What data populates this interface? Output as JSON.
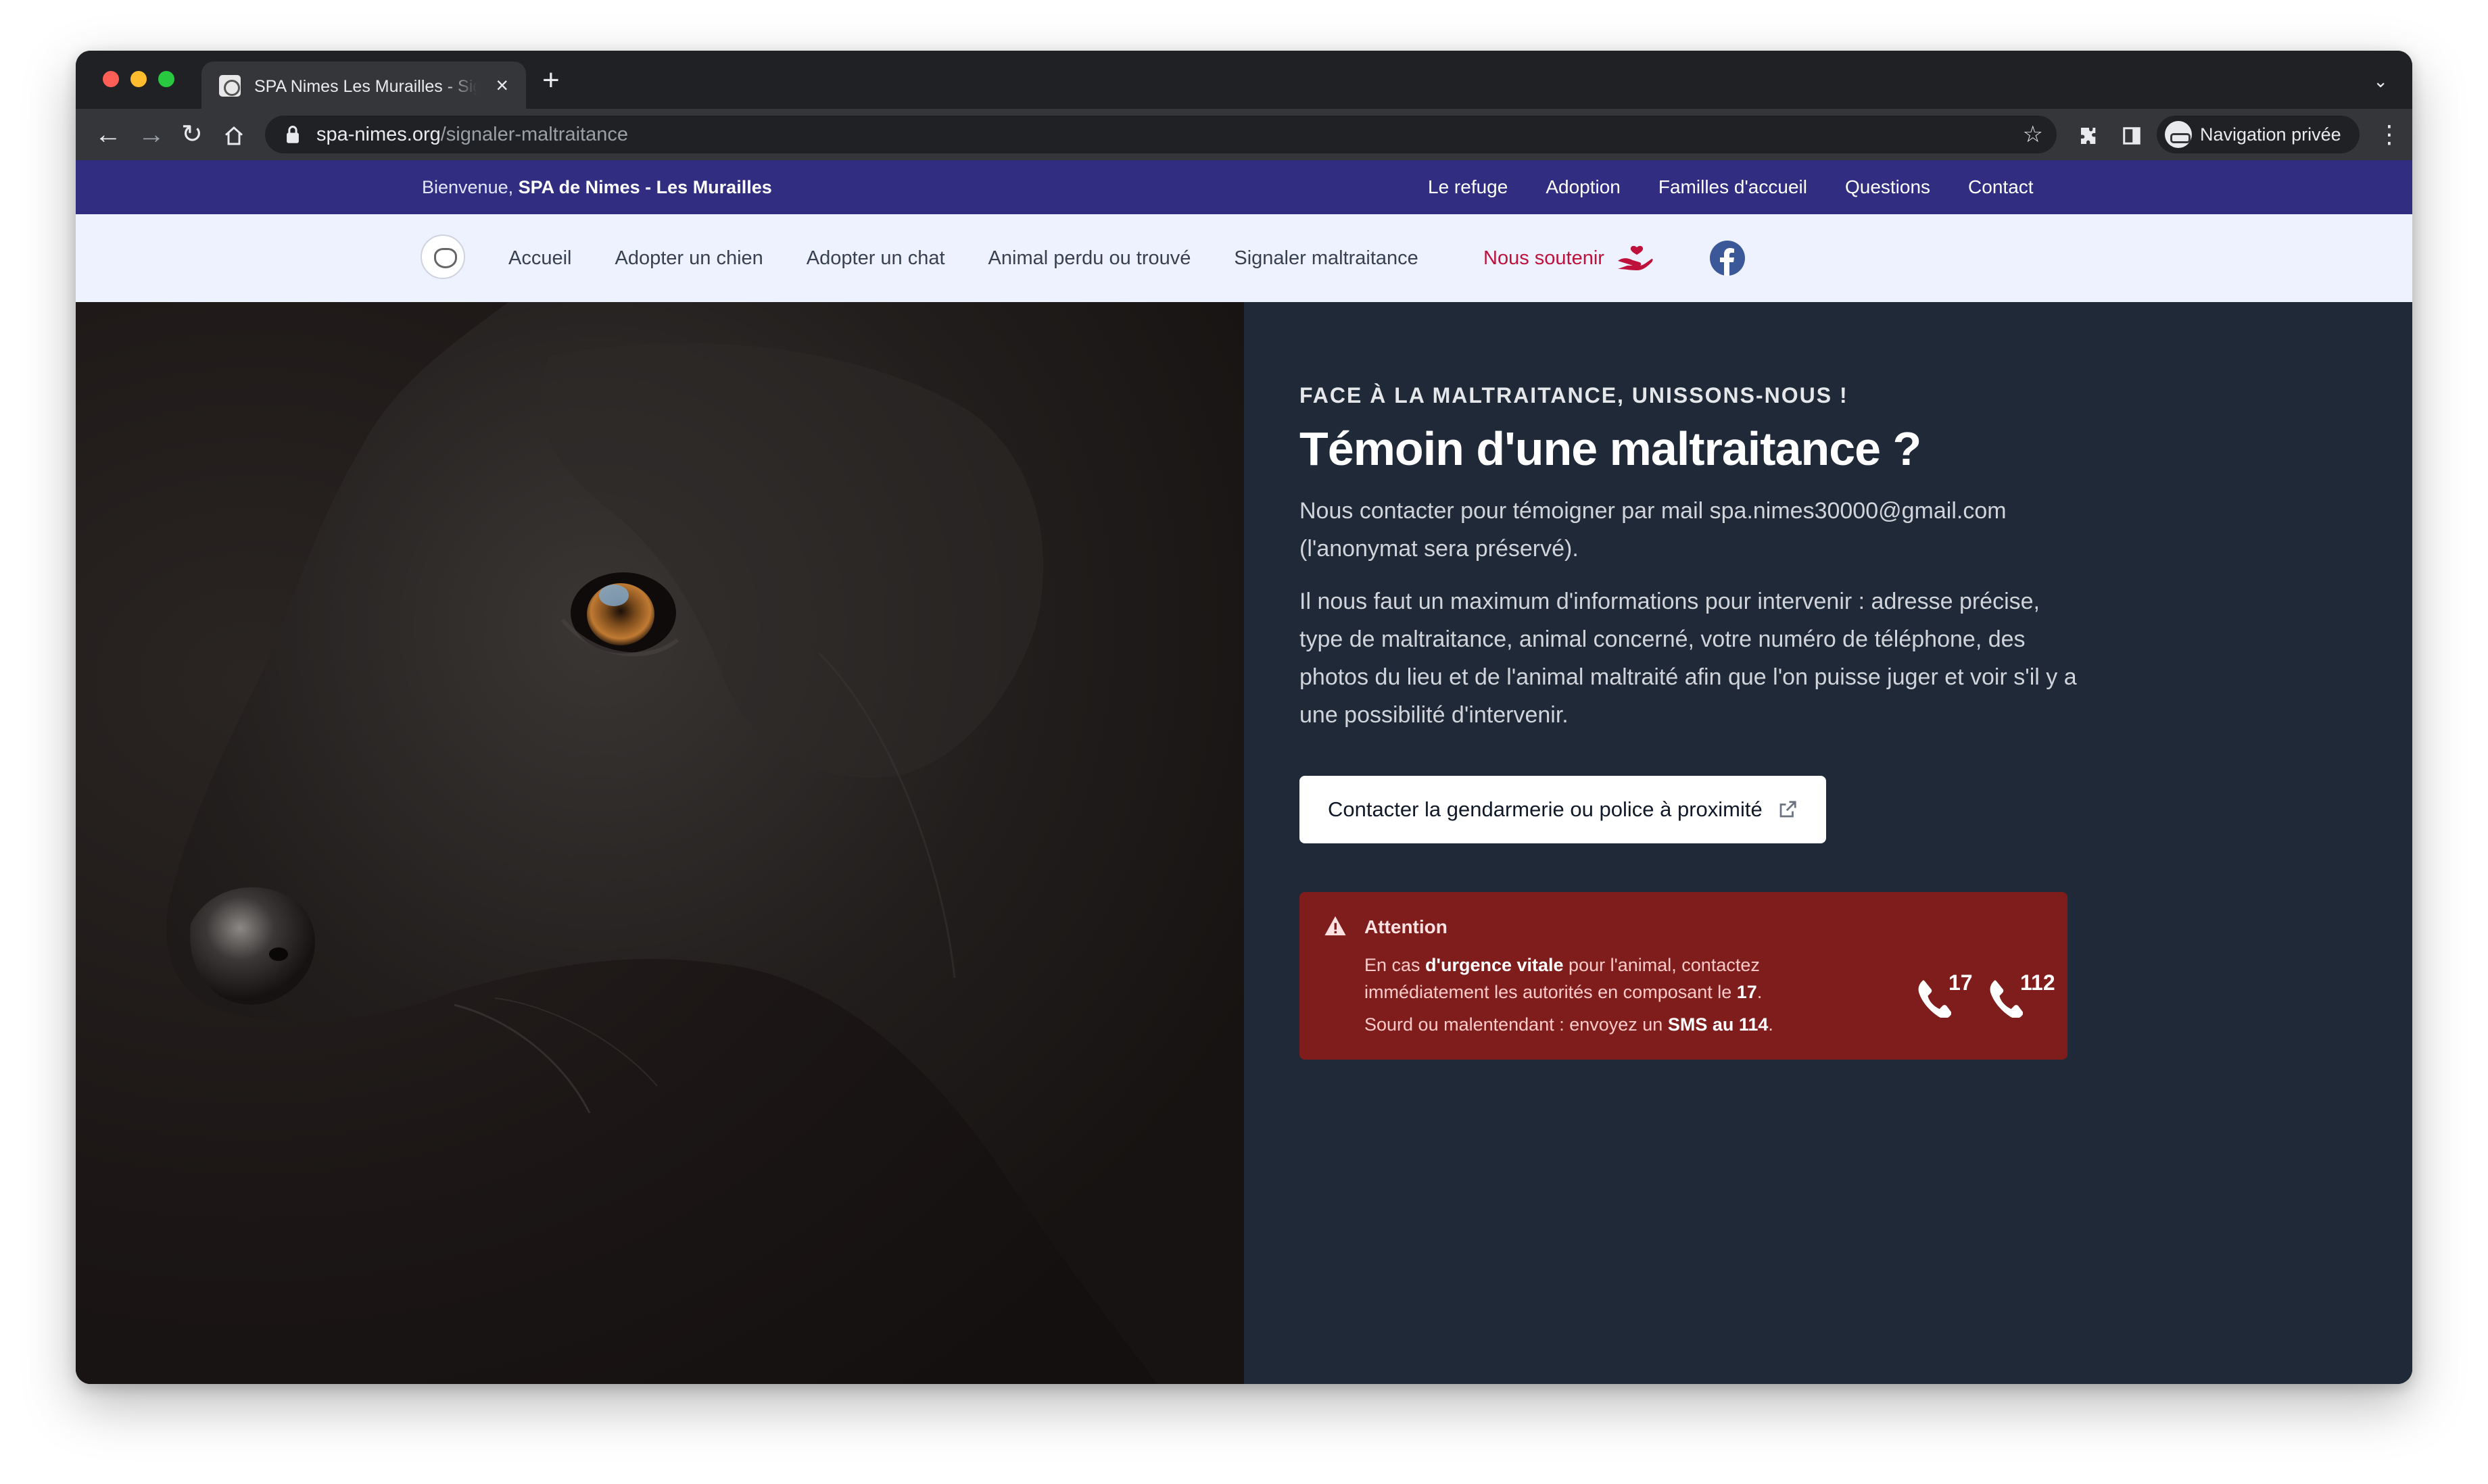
{
  "browser": {
    "tab_title": "SPA Nimes Les Murailles - Signaler maltraitance",
    "url_domain": "spa-nimes.org",
    "url_path": "/signaler-maltraitance",
    "profile_label": "Navigation privée"
  },
  "topbar": {
    "welcome_prefix": "Bienvenue, ",
    "welcome_org": "SPA de Nimes - Les Murailles",
    "links": [
      "Le refuge",
      "Adoption",
      "Familles d'accueil",
      "Questions",
      "Contact"
    ]
  },
  "nav": {
    "items": [
      "Accueil",
      "Adopter un chien",
      "Adopter un chat",
      "Animal perdu ou trouvé",
      "Signaler maltraitance"
    ],
    "support_label": "Nous soutenir"
  },
  "hero": {
    "eyebrow": "FACE À LA MALTRAITANCE, UNISSONS-NOUS !",
    "title": "Témoin d'une maltraitance ?",
    "intro": "Nous contacter pour témoigner par mail spa.nimes30000@gmail.com (l'anonymat sera préservé).",
    "details": "Il nous faut un maximum d'informations pour intervenir : adresse précise, type de maltraitance, animal concerné, votre numéro de téléphone, des photos du lieu et de l'animal maltraité afin que l'on puisse juger et voir s'il y a une possibilité d'intervenir.",
    "cta_label": "Contacter la gendarmerie ou police à proximité"
  },
  "alert": {
    "title": "Attention",
    "l1_a": "En cas ",
    "l1_b": "d'urgence vitale",
    "l1_c": " pour l'animal, contactez immédiatement les autorités en composant le ",
    "l1_d": "17",
    "l1_e": ".",
    "l2_a": "Sourd ou malentendant : envoyez un ",
    "l2_b": "SMS au 114",
    "l2_c": ".",
    "phone1": "17",
    "phone2": "112"
  },
  "colors": {
    "topbar": "#312e81",
    "nav_bg": "#eef2ff",
    "hero_bg": "#1f2937",
    "alert_bg": "#7f1d1d",
    "support": "#be123c",
    "facebook": "#3b5998"
  }
}
